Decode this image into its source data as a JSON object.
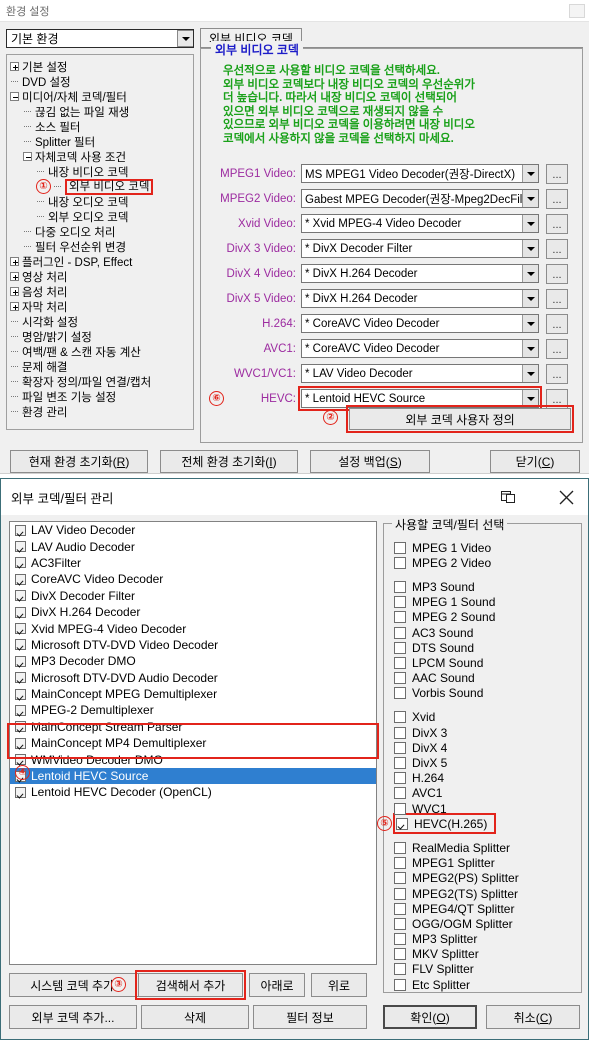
{
  "window1": {
    "title": "환경 설정",
    "env_combo": {
      "value": "기본 환경"
    },
    "tab": {
      "label": "외부 비디오 코덱"
    },
    "group": {
      "title": "외부 비디오 코덱",
      "description": "우선적으로 사용할 비디오 코덱을 선택하세요.\n외부 비디오 코덱보다 내장 비디오 코덱의 우선순위가\n더 높습니다. 따라서 내장 비디오 코덱이 선택되어\n있으면 외부 비디오 코덱으로 재생되지 않을 수\n있으므로 외부 비디오 코덱을 이용하려면 내장 비디오\n코덱에서 사용하지 않을 코덱을 선택하지 마세요."
    },
    "tree": [
      {
        "label": "기본 설정",
        "indent": 0,
        "node": "plus"
      },
      {
        "label": "DVD 설정",
        "indent": 0,
        "node": "dash"
      },
      {
        "label": "미디어/자체 코덱/필터",
        "indent": 0,
        "node": "minus"
      },
      {
        "label": "끊김 없는 파일 재생",
        "indent": 1,
        "node": "dash"
      },
      {
        "label": "소스 필터",
        "indent": 1,
        "node": "dash"
      },
      {
        "label": "Splitter 필터",
        "indent": 1,
        "node": "dash"
      },
      {
        "label": "자체코덱 사용 조건",
        "indent": 1,
        "node": "minus"
      },
      {
        "label": "내장 비디오 코덱",
        "indent": 2,
        "node": "dash"
      },
      {
        "label": "외부 비디오 코덱",
        "indent": 2,
        "node": "dash",
        "selected": true,
        "marker": "①"
      },
      {
        "label": "내장 오디오 코덱",
        "indent": 2,
        "node": "dash"
      },
      {
        "label": "외부 오디오 코덱",
        "indent": 2,
        "node": "dash"
      },
      {
        "label": "다중 오디오 처리",
        "indent": 1,
        "node": "dash"
      },
      {
        "label": "필터 우선순위 변경",
        "indent": 1,
        "node": "dash"
      },
      {
        "label": "플러그인 - DSP, Effect",
        "indent": 0,
        "node": "plus"
      },
      {
        "label": "영상 처리",
        "indent": 0,
        "node": "plus"
      },
      {
        "label": "음성 처리",
        "indent": 0,
        "node": "plus"
      },
      {
        "label": "자막 처리",
        "indent": 0,
        "node": "plus"
      },
      {
        "label": "시각화 설정",
        "indent": 0,
        "node": "dash"
      },
      {
        "label": "명암/밝기 설정",
        "indent": 0,
        "node": "dash"
      },
      {
        "label": "여백/팬 & 스캔 자동 계산",
        "indent": 0,
        "node": "dash"
      },
      {
        "label": "문제 해결",
        "indent": 0,
        "node": "dash"
      },
      {
        "label": "확장자 정의/파일 연결/캡처",
        "indent": 0,
        "node": "dash"
      },
      {
        "label": "파일 변조 기능 설정",
        "indent": 0,
        "node": "dash"
      },
      {
        "label": "환경 관리",
        "indent": 0,
        "node": "dash"
      }
    ],
    "codec_rows": [
      {
        "label": "MPEG1 Video:",
        "value": "MS MPEG1 Video Decoder(권장-DirectX)",
        "button": "..."
      },
      {
        "label": "MPEG2 Video:",
        "value": "Gabest MPEG Decoder(권장-Mpeg2DecFil",
        "button": "..."
      },
      {
        "label": "Xvid Video:",
        "value": "* Xvid MPEG-4 Video Decoder",
        "button": "..."
      },
      {
        "label": "DivX 3 Video:",
        "value": "* DivX Decoder Filter",
        "button": "..."
      },
      {
        "label": "DivX 4 Video:",
        "value": "* DivX H.264 Decoder",
        "button": "..."
      },
      {
        "label": "DivX 5 Video:",
        "value": "* DivX H.264 Decoder",
        "button": "..."
      },
      {
        "label": "H.264:",
        "value": "* CoreAVC Video Decoder",
        "button": "..."
      },
      {
        "label": "AVC1:",
        "value": "* CoreAVC Video Decoder",
        "button": "..."
      },
      {
        "label": "WVC1/VC1:",
        "value": "* LAV Video Decoder",
        "button": "..."
      },
      {
        "label": "HEVC:",
        "value": "* Lentoid HEVC Source",
        "button": "...",
        "highlight": true,
        "marker": "⑥"
      }
    ],
    "user_define_button": {
      "label": "외부 코덱 사용자 정의",
      "marker": "②"
    },
    "footer_buttons": [
      {
        "label": "현재 환경 초기화(R)",
        "accel": "R"
      },
      {
        "label": "전체 환경 초기화(I)",
        "accel": "I"
      },
      {
        "label": "설정 백업(S)",
        "accel": "S"
      },
      {
        "label": "닫기(C)",
        "accel": "C"
      }
    ]
  },
  "window2": {
    "title": "외부 코덱/필터 관리",
    "close_icon": "close-icon",
    "window_icon": "window-icon",
    "codec_list": [
      {
        "label": "LAV Video Decoder",
        "checked": true
      },
      {
        "label": "LAV Audio Decoder",
        "checked": true
      },
      {
        "label": "AC3Filter",
        "checked": true
      },
      {
        "label": "CoreAVC Video Decoder",
        "checked": true
      },
      {
        "label": "DivX Decoder Filter",
        "checked": true
      },
      {
        "label": "DivX H.264 Decoder",
        "checked": true
      },
      {
        "label": "Xvid MPEG-4 Video Decoder",
        "checked": true
      },
      {
        "label": "Microsoft DTV-DVD Video Decoder",
        "checked": true
      },
      {
        "label": "MP3 Decoder DMO",
        "checked": true
      },
      {
        "label": "Microsoft DTV-DVD Audio Decoder",
        "checked": true
      },
      {
        "label": "MainConcept MPEG Demultiplexer",
        "checked": true
      },
      {
        "label": "MPEG-2 Demultiplexer",
        "checked": true
      },
      {
        "label": "MainConcept Stream Parser",
        "checked": true
      },
      {
        "label": "MainConcept MP4 Demultiplexer",
        "checked": true
      },
      {
        "label": "WMVideo Decoder DMO",
        "checked": true
      },
      {
        "label": "Lentoid HEVC Source",
        "checked": true,
        "selected": true
      },
      {
        "label": "Lentoid HEVC Decoder (OpenCL)",
        "checked": true
      }
    ],
    "list_marker": "④",
    "filter_group": {
      "title": "사용할 코덱/필터 선택",
      "groups": [
        [
          {
            "label": "MPEG 1 Video",
            "checked": false
          },
          {
            "label": "MPEG 2 Video",
            "checked": false
          }
        ],
        [
          {
            "label": "MP3 Sound",
            "checked": false
          },
          {
            "label": "MPEG 1 Sound",
            "checked": false
          },
          {
            "label": "MPEG 2 Sound",
            "checked": false
          },
          {
            "label": "AC3 Sound",
            "checked": false
          },
          {
            "label": "DTS Sound",
            "checked": false
          },
          {
            "label": "LPCM Sound",
            "checked": false
          },
          {
            "label": "AAC Sound",
            "checked": false
          },
          {
            "label": "Vorbis Sound",
            "checked": false
          }
        ],
        [
          {
            "label": "Xvid",
            "checked": false
          },
          {
            "label": "DivX 3",
            "checked": false
          },
          {
            "label": "DivX 4",
            "checked": false
          },
          {
            "label": "DivX 5",
            "checked": false
          },
          {
            "label": "H.264",
            "checked": false
          },
          {
            "label": "AVC1",
            "checked": false
          },
          {
            "label": "WVC1",
            "checked": false
          },
          {
            "label": "HEVC(H.265)",
            "checked": true,
            "highlight": true,
            "marker": "⑤"
          }
        ],
        [
          {
            "label": "RealMedia Splitter",
            "checked": false
          },
          {
            "label": "MPEG1 Splitter",
            "checked": false
          },
          {
            "label": "MPEG2(PS) Splitter",
            "checked": false
          },
          {
            "label": "MPEG2(TS) Splitter",
            "checked": false
          },
          {
            "label": "MPEG4/QT Splitter",
            "checked": false
          },
          {
            "label": "OGG/OGM Splitter",
            "checked": false
          },
          {
            "label": "MP3 Splitter",
            "checked": false
          },
          {
            "label": "MKV Splitter",
            "checked": false
          },
          {
            "label": "FLV Splitter",
            "checked": false
          },
          {
            "label": "Etc Splitter",
            "checked": false
          }
        ]
      ]
    },
    "buttons_row1": [
      {
        "label": "시스템 코덱 추가.."
      },
      {
        "label": "검색해서 추가",
        "highlight": true,
        "marker": "③"
      },
      {
        "label": "아래로"
      },
      {
        "label": "위로"
      }
    ],
    "buttons_row2": [
      {
        "label": "외부 코덱 추가..."
      },
      {
        "label": "삭제"
      },
      {
        "label": "필터 정보"
      }
    ],
    "buttons_ok_cancel": [
      {
        "label": "확인(O)",
        "default": true
      },
      {
        "label": "취소(C)"
      }
    ]
  },
  "colors": {
    "group_title": "#1c1cc8",
    "description": "#1aa11a",
    "codec_label": "#9c2ba0",
    "marker": "#e2241b",
    "selection": "#2f7fd0"
  }
}
